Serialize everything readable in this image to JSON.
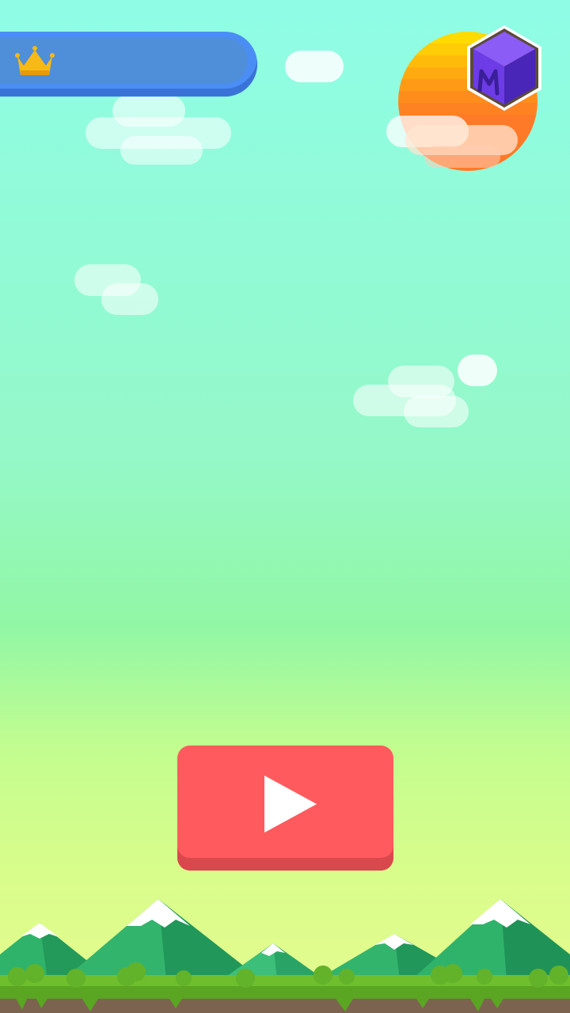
{
  "game": {
    "best_score": "",
    "play_label": ""
  },
  "icons": {
    "crown": "crown-icon",
    "logo": "cube-logo-icon",
    "play": "play-icon"
  },
  "colors": {
    "sky_top": "#8ffde6",
    "sky_bottom": "#e6fb8f",
    "banner": "#4a8ef5",
    "play_button": "#ff5b5e",
    "crown": "#f7b916",
    "sun": "#ffb000"
  }
}
